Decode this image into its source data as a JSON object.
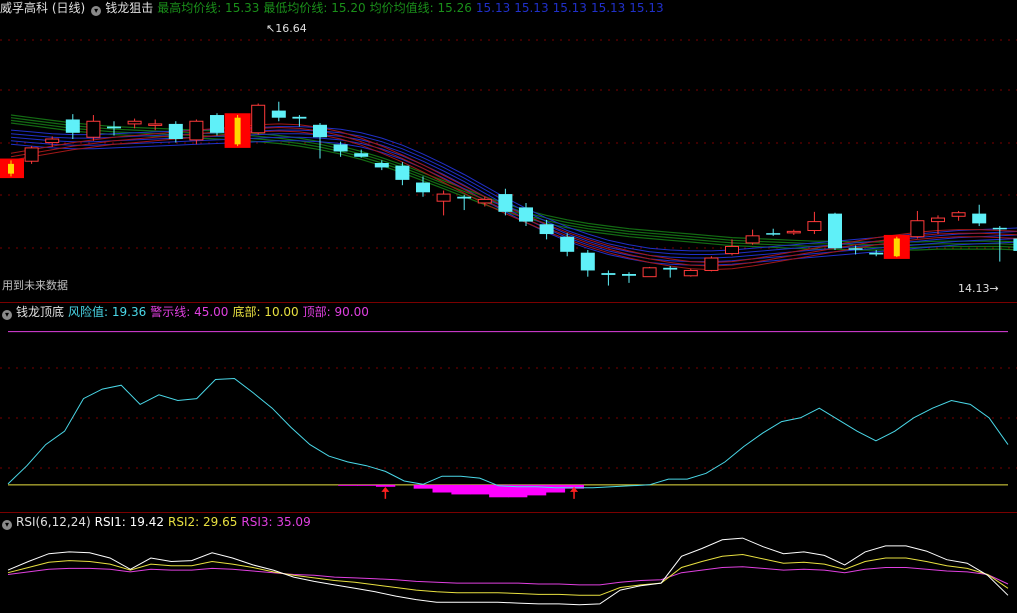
{
  "main": {
    "stock_title": "威孚高科 (日线)",
    "indicator_name": "钱龙狙击",
    "labels": [
      {
        "text": "最高均价线: 15.33",
        "color": "#1a8f1a"
      },
      {
        "text": "最低均价线: 15.20",
        "color": "#1a8f1a"
      },
      {
        "text": "均价均值线: 15.26",
        "color": "#1a8f1a"
      },
      {
        "text": "15.13",
        "color": "#2030c8"
      },
      {
        "text": "15.13",
        "color": "#2030c8"
      },
      {
        "text": "15.13",
        "color": "#2030c8"
      },
      {
        "text": "15.13",
        "color": "#2030c8"
      },
      {
        "text": "15.13",
        "color": "#2030c8"
      }
    ],
    "high_label": "16.64",
    "low_label": "14.13",
    "future_note": "用到未来数据",
    "candles": [
      {
        "o": 14.99,
        "c": 15.1,
        "h": 15.14,
        "l": 14.96,
        "signal": true
      },
      {
        "o": 15.13,
        "c": 15.28,
        "h": 15.3,
        "l": 15.1
      },
      {
        "o": 15.34,
        "c": 15.38,
        "h": 15.41,
        "l": 15.29
      },
      {
        "o": 15.6,
        "c": 15.45,
        "h": 15.66,
        "l": 15.38
      },
      {
        "o": 15.4,
        "c": 15.58,
        "h": 15.65,
        "l": 15.36
      },
      {
        "o": 15.52,
        "c": 15.5,
        "h": 15.58,
        "l": 15.42
      },
      {
        "o": 15.55,
        "c": 15.58,
        "h": 15.61,
        "l": 15.5
      },
      {
        "o": 15.54,
        "c": 15.55,
        "h": 15.6,
        "l": 15.48
      },
      {
        "o": 15.55,
        "c": 15.38,
        "h": 15.58,
        "l": 15.34
      },
      {
        "o": 15.37,
        "c": 15.58,
        "h": 15.6,
        "l": 15.32
      },
      {
        "o": 15.65,
        "c": 15.45,
        "h": 15.67,
        "l": 15.42
      },
      {
        "o": 15.32,
        "c": 15.62,
        "h": 15.65,
        "l": 15.3,
        "signal": true
      },
      {
        "o": 15.45,
        "c": 15.76,
        "h": 15.78,
        "l": 15.43
      },
      {
        "o": 15.7,
        "c": 15.62,
        "h": 15.8,
        "l": 15.58
      },
      {
        "o": 15.63,
        "c": 15.61,
        "h": 15.65,
        "l": 15.52
      },
      {
        "o": 15.54,
        "c": 15.4,
        "h": 15.56,
        "l": 15.16
      },
      {
        "o": 15.32,
        "c": 15.24,
        "h": 15.35,
        "l": 15.18
      },
      {
        "o": 15.22,
        "c": 15.18,
        "h": 15.26,
        "l": 15.17
      },
      {
        "o": 15.11,
        "c": 15.06,
        "h": 15.14,
        "l": 15.03
      },
      {
        "o": 15.08,
        "c": 14.92,
        "h": 15.12,
        "l": 14.86
      },
      {
        "o": 14.89,
        "c": 14.78,
        "h": 14.96,
        "l": 14.73
      },
      {
        "o": 14.68,
        "c": 14.76,
        "h": 14.8,
        "l": 14.52
      },
      {
        "o": 14.73,
        "c": 14.71,
        "h": 14.75,
        "l": 14.58
      },
      {
        "o": 14.66,
        "c": 14.7,
        "h": 14.73,
        "l": 14.62
      },
      {
        "o": 14.76,
        "c": 14.56,
        "h": 14.82,
        "l": 14.52
      },
      {
        "o": 14.61,
        "c": 14.45,
        "h": 14.66,
        "l": 14.4
      },
      {
        "o": 14.42,
        "c": 14.31,
        "h": 14.47,
        "l": 14.25
      },
      {
        "o": 14.28,
        "c": 14.11,
        "h": 14.32,
        "l": 14.06
      },
      {
        "o": 14.1,
        "c": 13.9,
        "h": 14.13,
        "l": 13.83
      },
      {
        "o": 13.87,
        "c": 13.85,
        "h": 13.9,
        "l": 13.73
      },
      {
        "o": 13.86,
        "c": 13.84,
        "h": 13.88,
        "l": 13.76
      },
      {
        "o": 13.83,
        "c": 13.93,
        "h": 13.94,
        "l": 13.83
      },
      {
        "o": 13.93,
        "c": 13.91,
        "h": 13.95,
        "l": 13.82
      },
      {
        "o": 13.84,
        "c": 13.9,
        "h": 13.92,
        "l": 13.83
      },
      {
        "o": 13.9,
        "c": 14.04,
        "h": 14.06,
        "l": 13.89
      },
      {
        "o": 14.09,
        "c": 14.17,
        "h": 14.25,
        "l": 14.07
      },
      {
        "o": 14.21,
        "c": 14.29,
        "h": 14.36,
        "l": 14.19
      },
      {
        "o": 14.32,
        "c": 14.31,
        "h": 14.37,
        "l": 14.29
      },
      {
        "o": 14.33,
        "c": 14.34,
        "h": 14.36,
        "l": 14.3
      },
      {
        "o": 14.35,
        "c": 14.45,
        "h": 14.56,
        "l": 14.31
      },
      {
        "o": 14.54,
        "c": 14.15,
        "h": 14.55,
        "l": 14.13
      },
      {
        "o": 14.15,
        "c": 14.14,
        "h": 14.18,
        "l": 14.08
      },
      {
        "o": 14.1,
        "c": 14.08,
        "h": 14.13,
        "l": 14.06
      },
      {
        "o": 14.06,
        "c": 14.26,
        "h": 14.28,
        "l": 14.05,
        "signal": true
      },
      {
        "o": 14.28,
        "c": 14.46,
        "h": 14.57,
        "l": 14.26
      },
      {
        "o": 14.45,
        "c": 14.49,
        "h": 14.52,
        "l": 14.31
      },
      {
        "o": 14.51,
        "c": 14.55,
        "h": 14.57,
        "l": 14.46
      },
      {
        "o": 14.54,
        "c": 14.43,
        "h": 14.64,
        "l": 14.4
      },
      {
        "o": 14.38,
        "c": 14.37,
        "h": 14.4,
        "l": 14.0
      },
      {
        "o": 14.26,
        "c": 14.12,
        "h": 14.28,
        "l": 14.1
      },
      {
        "o": 14.09,
        "c": 13.78,
        "h": 14.1,
        "l": 13.74
      }
    ],
    "ma_green": [
      [
        15.65,
        15.62,
        15.59,
        15.56,
        15.54,
        15.52,
        15.51,
        15.5,
        15.49,
        15.48,
        15.47,
        15.46,
        15.44,
        15.42,
        15.39,
        15.35,
        15.3,
        15.24,
        15.17,
        15.09,
        15.0,
        14.91,
        14.82,
        14.73,
        14.65,
        14.58,
        14.52,
        14.47,
        14.43,
        14.4,
        14.37,
        14.35,
        14.33,
        14.31,
        14.29,
        14.27,
        14.26,
        14.25,
        14.24,
        14.23,
        14.23,
        14.22,
        14.22,
        14.22,
        14.22,
        14.23,
        14.23,
        14.23,
        14.23,
        14.22,
        14.22
      ],
      [
        15.62,
        15.59,
        15.56,
        15.53,
        15.51,
        15.49,
        15.48,
        15.47,
        15.46,
        15.45,
        15.44,
        15.43,
        15.41,
        15.39,
        15.36,
        15.32,
        15.27,
        15.21,
        15.14,
        15.06,
        14.97,
        14.88,
        14.79,
        14.7,
        14.62,
        14.55,
        14.49,
        14.44,
        14.4,
        14.37,
        14.34,
        14.32,
        14.3,
        14.28,
        14.26,
        14.24,
        14.23,
        14.22,
        14.21,
        14.2,
        14.2,
        14.19,
        14.19,
        14.19,
        14.19,
        14.2,
        14.2,
        14.2,
        14.2,
        14.19,
        14.19
      ],
      [
        15.59,
        15.56,
        15.53,
        15.5,
        15.48,
        15.46,
        15.45,
        15.44,
        15.43,
        15.42,
        15.41,
        15.4,
        15.38,
        15.36,
        15.33,
        15.29,
        15.24,
        15.18,
        15.11,
        15.03,
        14.94,
        14.85,
        14.76,
        14.67,
        14.59,
        14.52,
        14.46,
        14.41,
        14.37,
        14.34,
        14.31,
        14.29,
        14.27,
        14.25,
        14.23,
        14.21,
        14.2,
        14.19,
        14.18,
        14.17,
        14.17,
        14.16,
        14.16,
        14.16,
        14.16,
        14.17,
        14.17,
        14.17,
        14.17,
        14.16,
        14.16
      ],
      [
        15.56,
        15.53,
        15.5,
        15.47,
        15.45,
        15.43,
        15.42,
        15.41,
        15.4,
        15.39,
        15.38,
        15.37,
        15.35,
        15.33,
        15.3,
        15.26,
        15.21,
        15.15,
        15.08,
        15.0,
        14.91,
        14.82,
        14.73,
        14.64,
        14.56,
        14.49,
        14.43,
        14.38,
        14.34,
        14.31,
        14.28,
        14.26,
        14.24,
        14.22,
        14.2,
        14.18,
        14.17,
        14.16,
        14.15,
        14.14,
        14.14,
        14.13,
        14.13,
        14.13,
        14.13,
        14.14,
        14.14,
        14.14,
        14.14,
        14.13,
        14.13
      ]
    ],
    "ma_blue_offsets": [
      0.08,
      0.04,
      0.0,
      -0.04,
      -0.08
    ],
    "ma_blue": [
      15.4,
      15.38,
      15.36,
      15.35,
      15.35,
      15.36,
      15.37,
      15.38,
      15.39,
      15.4,
      15.41,
      15.42,
      15.43,
      15.44,
      15.44,
      15.43,
      15.41,
      15.37,
      15.31,
      15.23,
      15.13,
      15.02,
      14.9,
      14.77,
      14.64,
      14.52,
      14.41,
      14.31,
      14.23,
      14.16,
      14.11,
      14.07,
      14.05,
      14.04,
      14.04,
      14.05,
      14.07,
      14.09,
      14.11,
      14.13,
      14.15,
      14.17,
      14.19,
      14.21,
      14.23,
      14.25,
      14.27,
      14.28,
      14.29,
      14.3,
      14.3
    ],
    "ma_red_offsets": [
      0.04,
      0.0,
      -0.04
    ],
    "ma_red": [
      15.18,
      15.22,
      15.26,
      15.3,
      15.33,
      15.36,
      15.38,
      15.4,
      15.42,
      15.44,
      15.46,
      15.48,
      15.5,
      15.51,
      15.5,
      15.47,
      15.42,
      15.35,
      15.26,
      15.16,
      15.05,
      14.93,
      14.81,
      14.69,
      14.58,
      14.48,
      14.38,
      14.29,
      14.21,
      14.14,
      14.08,
      14.03,
      13.99,
      13.96,
      13.95,
      13.96,
      13.99,
      14.03,
      14.07,
      14.11,
      14.15,
      14.19,
      14.23,
      14.26,
      14.29,
      14.31,
      14.32,
      14.32,
      14.31,
      14.3,
      14.29
    ],
    "y_range": [
      13.68,
      16.72
    ]
  },
  "mid": {
    "title": "钱龙顶底",
    "labels": [
      {
        "text": "风险值: 19.36",
        "color": "#4ad8e8"
      },
      {
        "text": "警示线: 45.00",
        "color": "#e040e0"
      },
      {
        "text": "底部: 10.00",
        "color": "#e8e040"
      },
      {
        "text": "顶部: 90.00",
        "color": "#e040e0"
      }
    ],
    "risk": [
      10.5,
      20,
      31,
      38,
      55,
      60,
      62,
      52,
      57,
      54,
      55,
      65,
      65.5,
      58,
      50,
      40,
      31,
      25,
      22,
      20,
      17,
      12,
      10.3,
      14.5,
      14.5,
      13.5,
      9.5,
      9,
      9,
      8.5,
      8.5,
      8.5,
      9,
      9.5,
      10,
      13,
      13,
      16,
      22,
      30,
      37,
      43,
      45,
      50,
      44,
      38,
      33,
      38,
      45,
      50,
      54,
      52,
      45,
      31
    ],
    "warn_line": 45,
    "bottom_line": 10,
    "top_line": 90,
    "bars": [
      {
        "i": 18,
        "v": 9.5
      },
      {
        "i": 19,
        "v": 9.5
      },
      {
        "i": 20,
        "v": 9
      },
      {
        "i": 22,
        "v": 8
      },
      {
        "i": 23,
        "v": 6
      },
      {
        "i": 24,
        "v": 5
      },
      {
        "i": 25,
        "v": 5
      },
      {
        "i": 26,
        "v": 3.5
      },
      {
        "i": 27,
        "v": 3.5
      },
      {
        "i": 28,
        "v": 4.5
      },
      {
        "i": 29,
        "v": 6
      },
      {
        "i": 30,
        "v": 8
      }
    ],
    "arrows": [
      20,
      30
    ],
    "y_range": [
      0,
      95
    ]
  },
  "rsi": {
    "title": "RSI(6,12,24)",
    "labels": [
      {
        "text": "RSI1: 19.42",
        "color": "#ffffff"
      },
      {
        "text": "RSI2: 29.65",
        "color": "#e8e040"
      },
      {
        "text": "RSI3: 35.09",
        "color": "#e040e0"
      }
    ],
    "rsi1": [
      51,
      61,
      70,
      72,
      71,
      65,
      52,
      65,
      61,
      62,
      71,
      65,
      57,
      51,
      43,
      38,
      34,
      30,
      26,
      21,
      17,
      14,
      14,
      14,
      14,
      13,
      12,
      12,
      11,
      12,
      28,
      33,
      36,
      67,
      76,
      86,
      88,
      78,
      70,
      72,
      68,
      57,
      72,
      79,
      79,
      73,
      63,
      59,
      45,
      22
    ],
    "rsi2": [
      48,
      54,
      60,
      62,
      61,
      58,
      51,
      58,
      56,
      56,
      61,
      58,
      54,
      49,
      45,
      42,
      39,
      37,
      34,
      31,
      28,
      26,
      25,
      25,
      25,
      24,
      23,
      23,
      22,
      22,
      31,
      34,
      36,
      54,
      61,
      67,
      69,
      64,
      59,
      60,
      58,
      52,
      61,
      65,
      65,
      61,
      56,
      53,
      46,
      30
    ],
    "rsi3": [
      46,
      49,
      52,
      53,
      53,
      52,
      49,
      52,
      51,
      51,
      53,
      52,
      50,
      48,
      46,
      45,
      43,
      42,
      41,
      40,
      38,
      37,
      36,
      36,
      36,
      36,
      35,
      35,
      34,
      34,
      37,
      39,
      40,
      48,
      51,
      54,
      55,
      53,
      51,
      52,
      51,
      48,
      52,
      54,
      54,
      52,
      50,
      49,
      46,
      35
    ],
    "y_range": [
      5,
      95
    ]
  }
}
